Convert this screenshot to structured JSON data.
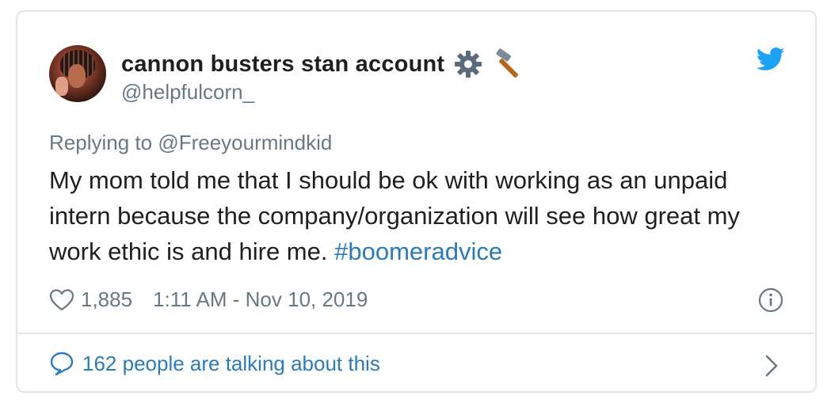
{
  "tweet": {
    "display_name": "cannon busters stan account",
    "name_emojis": [
      "gear-icon",
      "hammer-icon"
    ],
    "handle": "@helpfulcorn_",
    "replying_prefix": "Replying to",
    "replying_to": "@Freeyourmindkid",
    "text": "My mom told me that I should be ok with working as an unpaid intern because the company/organization will see how great my work ethic is and hire me.",
    "hashtag": "#boomeradvice",
    "likes": "1,885",
    "timestamp": "1:11 AM - Nov 10, 2019",
    "talking_text": "162 people are talking about this"
  },
  "colors": {
    "brand_blue": "#1da1f2",
    "link_blue": "#2b7bb9",
    "text": "#1c2022",
    "secondary_text": "#697882",
    "border": "#dfe5ea"
  }
}
